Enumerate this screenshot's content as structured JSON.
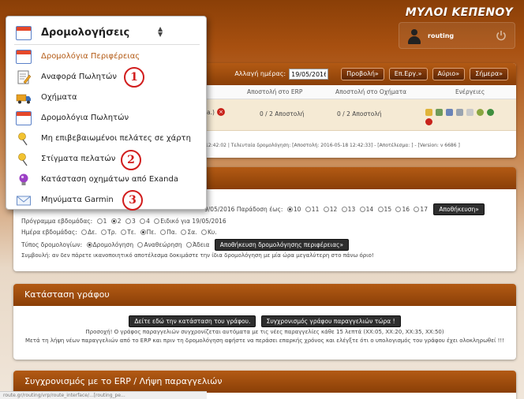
{
  "header": {
    "brand": "ΜΥΛΟΙ ΚΕΠΕΝΟΥ",
    "user": "routing"
  },
  "menu": {
    "title": "Δρομολογήσεις",
    "items": [
      {
        "label": "Δρομολόγια Περιφέρειας",
        "icon": "calendar-icon"
      },
      {
        "label": "Αναφορά Πωλητών",
        "icon": "report-icon"
      },
      {
        "label": "Οχήματα",
        "icon": "truck-icon"
      },
      {
        "label": "Δρομολόγια Πωλητών",
        "icon": "calendar-icon"
      },
      {
        "label": "Μη επιβεβαιωμένοι πελάτες σε χάρτη",
        "icon": "pushpin-icon"
      },
      {
        "label": "Στίγματα πελατών",
        "icon": "pushpin-icon"
      },
      {
        "label": "Κατάσταση οχημάτων από Exanda",
        "icon": "bulb-icon"
      },
      {
        "label": "Μηνύματα Garmin",
        "icon": "mail-icon"
      }
    ],
    "callouts": [
      "1",
      "2",
      "3"
    ]
  },
  "panel1": {
    "date_label": "Αλλαγή ημέρας:",
    "date_value": "19/05/2016",
    "buttons": [
      "Προβολή»",
      "Επ.Εργ.»",
      "Αύριο»",
      "Σήμερα»"
    ],
    "columns": [
      "Αποστολή στο ERP",
      "Αποστολή στο Οχήματα",
      "Ενέργειες"
    ],
    "row": {
      "prefix": "a.)",
      "erp": "0 / 2 Αποστολή",
      "vehicles": "0 / 2 Αποστολή"
    },
    "footline": "12:42:02 | Τελευταία δρομολόγηση: [Αποστολή: 2016-05-18 12:42:33] - [Αποτέλεσμα: ] - [Version: v 6686 ]"
  },
  "panel2": {
    "line1_prefix": "9/05/2016 Παράδοση έως:",
    "line1_options": [
      "10",
      "11",
      "12",
      "13",
      "14",
      "15",
      "16",
      "17"
    ],
    "line1_button": "Αποθήκευση»",
    "line2_label": "Πρόγραμμα εβδομάδας:",
    "line2_options": [
      "1",
      "2",
      "3",
      "4"
    ],
    "line2_extra": "Ειδικό για 19/05/2016",
    "line3_label": "Ημέρα εβδομάδας:",
    "line3_options": [
      "Δε.",
      "Τρ.",
      "Τε.",
      "Πε.",
      "Πα.",
      "Σα.",
      "Κυ."
    ],
    "line4_label": "Τύπος δρομολογίων:",
    "line4_options": [
      "Δρομολόγηση",
      "Αναθεώρηση",
      "Άδεια"
    ],
    "line4_button": "Αποθήκευση δρομολόγησης περιφέρειας»",
    "advice": "Συμβουλή: αν δεν πάρετε ικανοποιητικό αποτέλεσμα δοκιμάστε την ίδια δρομολόγηση με μία ώρα μεγαλύτερη στο πάνω όριο!"
  },
  "panel3": {
    "title": "Κατάσταση γράφου",
    "btn_view": "Δείτε εδώ την κατάσταση του γράφου.",
    "btn_sync": "Συγχρονισμός γράφου παραγγελιών τώρα !",
    "note1": "Προσοχή! Ο γράφος παραγγελιών συγχρονίζεται αυτόματα με τις νέες παραγγελίες κάθε 15 λεπτά (XX:05, XX:20, XX:35, XX:50)",
    "note2": "Μετά τη λήψη νέων παραγγελιών από το ERP και πριν τη δρομολόγηση αφήστε να περάσει επαρκής χρόνος και ελέγξτε ότι ο υπολογισμός του γράφου έχει ολοκληρωθεί !!!"
  },
  "panel4": {
    "title": "Συγχρονισμός με το ERP / Λήψη παραγγελιών"
  },
  "statusbar": "route.gr/routing/vrp/route_interface/...[routing_pe..."
}
